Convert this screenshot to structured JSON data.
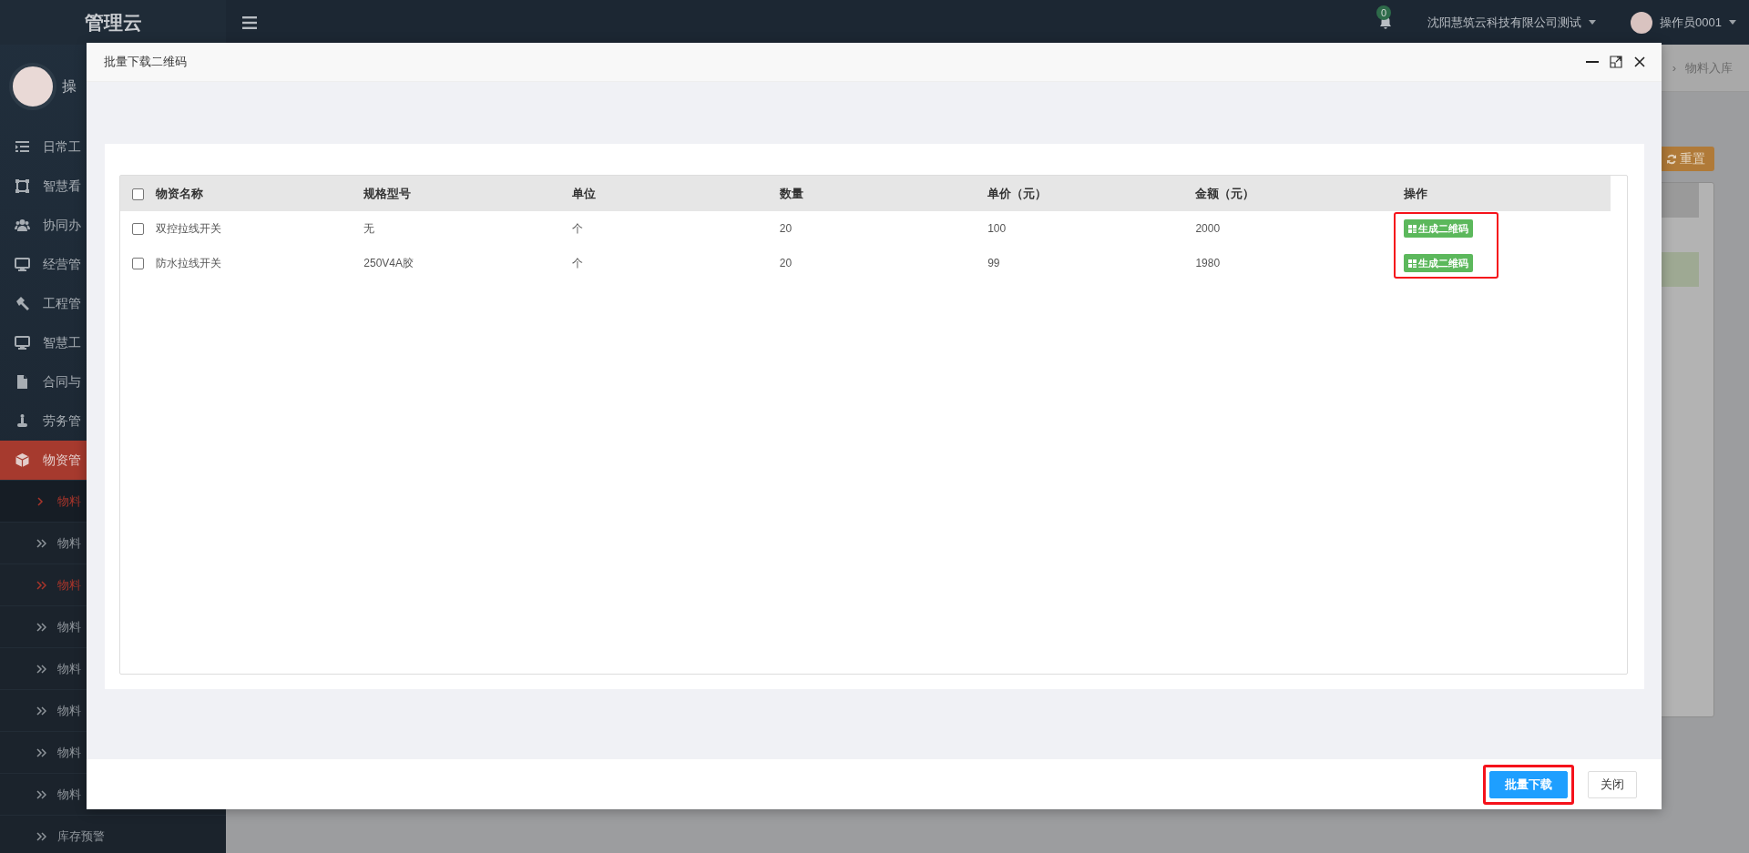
{
  "app": {
    "logo": "管理云"
  },
  "topbar": {
    "notifications": "0",
    "company": "沈阳慧筑云科技有限公司测试",
    "user": "操作员0001"
  },
  "sidebar": {
    "user_name": "操",
    "items": [
      {
        "label": "日常工",
        "selected": false
      },
      {
        "label": "智慧看",
        "selected": false
      },
      {
        "label": "协同办",
        "selected": false
      },
      {
        "label": "经营管",
        "selected": false
      },
      {
        "label": "工程管",
        "selected": false
      },
      {
        "label": "智慧工",
        "selected": false
      },
      {
        "label": "合同与",
        "selected": false
      },
      {
        "label": "劳务管",
        "selected": false
      },
      {
        "label": "物资管",
        "selected": true
      }
    ],
    "sub_items": [
      {
        "label": "物料",
        "kind": "current"
      },
      {
        "label": "物料",
        "kind": "plain"
      },
      {
        "label": "物料",
        "kind": "visited"
      },
      {
        "label": "物料",
        "kind": "plain"
      },
      {
        "label": "物料",
        "kind": "plain"
      },
      {
        "label": "物料",
        "kind": "plain"
      },
      {
        "label": "物料",
        "kind": "plain"
      },
      {
        "label": "物料",
        "kind": "plain"
      },
      {
        "label": "库存预警",
        "kind": "plain"
      }
    ]
  },
  "background_page": {
    "breadcrumb_separator": "›",
    "breadcrumb_current": "物料入库",
    "reset_button": "重置"
  },
  "modal": {
    "title": "批量下载二维码",
    "header_checked": false,
    "columns": [
      "物资名称",
      "规格型号",
      "单位",
      "数量",
      "单价（元）",
      "金额（元）",
      "操作"
    ],
    "rows": [
      {
        "checked": false,
        "cells": [
          "双控拉线开关",
          "无",
          "个",
          "20",
          "100",
          "2000"
        ],
        "action": "生成二维码"
      },
      {
        "checked": false,
        "cells": [
          "防水拉线开关",
          "250V4A胶",
          "个",
          "20",
          "99",
          "1980"
        ],
        "action": "生成二维码"
      }
    ],
    "actions_highlighted": true,
    "buttons": [
      {
        "label": "批量下载",
        "kind": "primary",
        "highlighted": true
      },
      {
        "label": "关闭",
        "kind": "default",
        "highlighted": false
      }
    ]
  }
}
